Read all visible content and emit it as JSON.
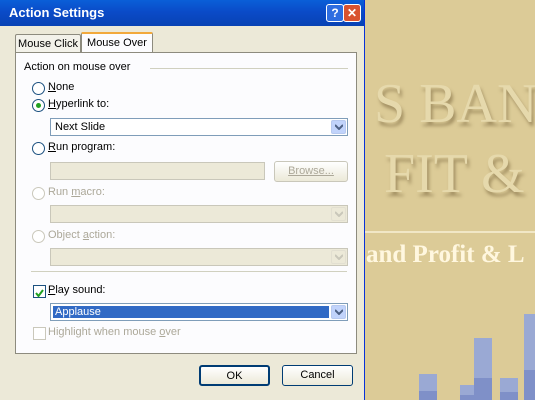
{
  "dialog": {
    "title": "Action Settings",
    "help_glyph": "?",
    "close_glyph": "✕",
    "tabs": [
      {
        "label": "Mouse Click",
        "selected": false
      },
      {
        "label": "Mouse Over",
        "selected": true
      }
    ],
    "group_title": "Action on mouse over",
    "options": {
      "none": {
        "label_first": "N",
        "label_rest": "one",
        "selected": false,
        "enabled": true
      },
      "hyperlink": {
        "label_first": "H",
        "label_rest": "yperlink to:",
        "selected": true,
        "enabled": true,
        "value": "Next Slide"
      },
      "run_program": {
        "label_first": "R",
        "label_rest": "un program:",
        "selected": false,
        "enabled": true,
        "value": "",
        "browse_label": "Browse..."
      },
      "run_macro": {
        "label_pre": "Run ",
        "label_u": "m",
        "label_post": "acro:",
        "selected": false,
        "enabled": false,
        "value": ""
      },
      "object_action": {
        "label_pre": "Object ",
        "label_u": "a",
        "label_post": "ction:",
        "selected": false,
        "enabled": false,
        "value": ""
      }
    },
    "play_sound": {
      "label_first": "P",
      "label_rest": "lay sound:",
      "checked": true,
      "value": "Applause"
    },
    "highlight": {
      "label_pre": "Highlight when mouse ",
      "label_u": "o",
      "label_post": "ver",
      "checked": false,
      "enabled": false
    },
    "ok_label": "OK",
    "cancel_label": "Cancel"
  },
  "slide": {
    "line1": "S BANK",
    "line2": "FIT & L",
    "subtitle": "and Profit & L",
    "bars": [
      0.26,
      0.15,
      0.62,
      0.22,
      0.86
    ]
  }
}
